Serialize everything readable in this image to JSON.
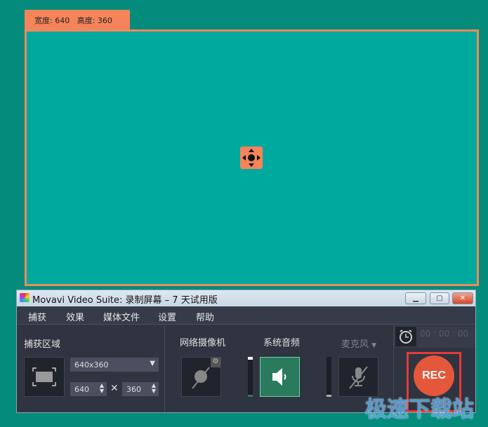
{
  "overlay": {
    "width_label": "宽度: 640",
    "height_label": "高度: 360"
  },
  "window": {
    "title": "Movavi Video Suite: 录制屏幕 – 7 天试用版",
    "minimize": "▁",
    "maximize": "▢",
    "close": "✕"
  },
  "menu": [
    "捕获",
    "效果",
    "媒体文件",
    "设置",
    "帮助"
  ],
  "capture_area": {
    "label": "捕获区域",
    "preset": "640x360",
    "width": "640",
    "height": "360",
    "times": "✕"
  },
  "webcam": {
    "label": "网络摄像机"
  },
  "system_audio": {
    "label": "系统音频"
  },
  "microphone": {
    "label": "麦克风"
  },
  "timer": {
    "value": "00 : 00 : 00"
  },
  "rec": {
    "label": "REC"
  },
  "watermark": "极速下载站",
  "colors": {
    "accent": "#f5845a",
    "capture_fill": "#00a99d",
    "rec": "#e4573b",
    "audio_on": "#2a7a5e"
  }
}
